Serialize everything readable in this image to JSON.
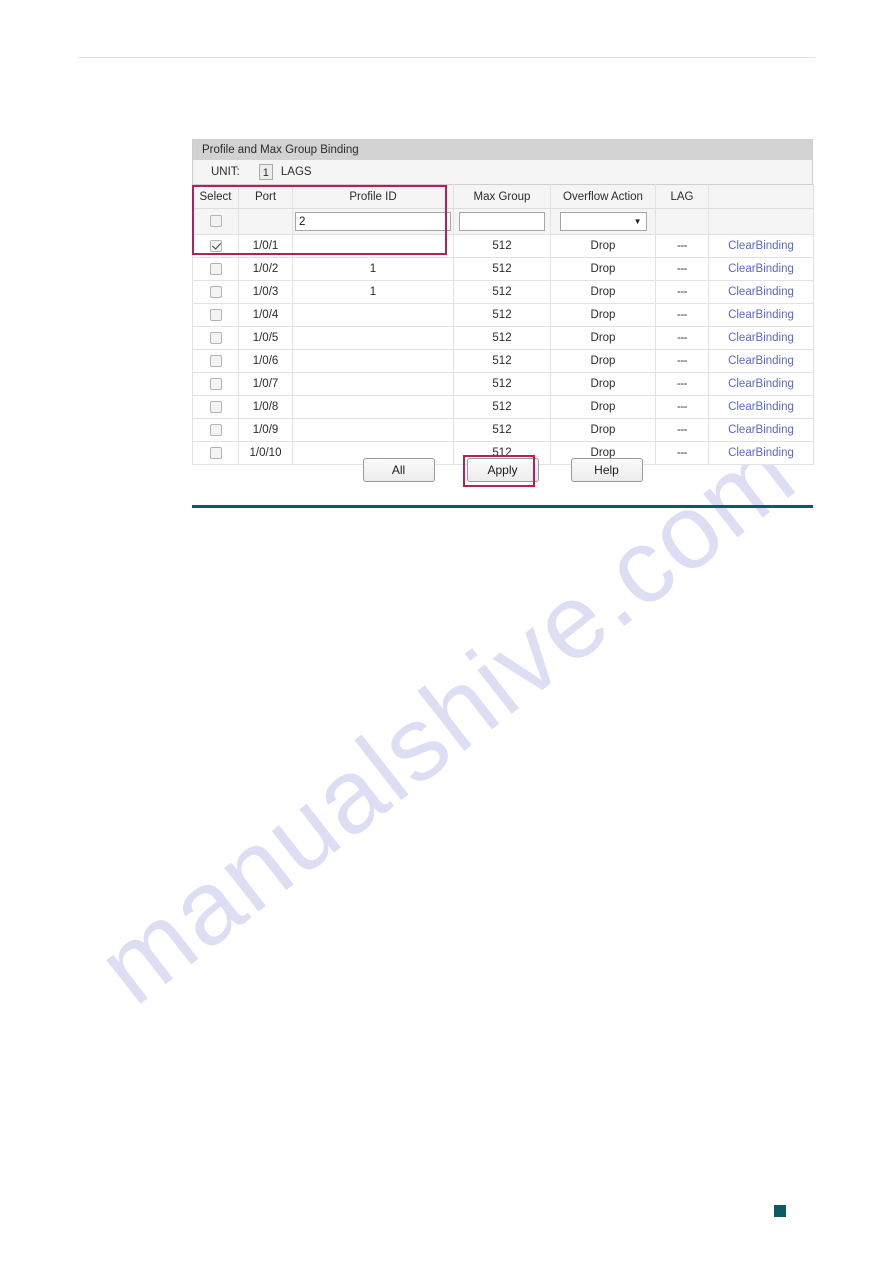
{
  "watermark": {
    "text": "manualshive.com"
  },
  "panel": {
    "title": "Profile and Max Group Binding",
    "unit": {
      "label": "UNIT:",
      "value": "1",
      "lags_label": "LAGS"
    },
    "columns": [
      "Select",
      "Port",
      "Profile ID",
      "Max Group",
      "Overflow Action",
      "LAG",
      ""
    ],
    "filter_row": {
      "select_checked": false,
      "port": "",
      "profile_id_value": "2",
      "profile_id_placeholder": "",
      "max_group_value": "",
      "max_group_placeholder": "",
      "overflow_action_value": "",
      "overflow_action_arrow": "▼",
      "lag": "",
      "action": ""
    },
    "rows": [
      {
        "selected": true,
        "port": "1/0/1",
        "profile_id": "",
        "max_group": "512",
        "overflow_action": "Drop",
        "lag": "---",
        "action": "ClearBinding"
      },
      {
        "selected": false,
        "port": "1/0/2",
        "profile_id": "1",
        "max_group": "512",
        "overflow_action": "Drop",
        "lag": "---",
        "action": "ClearBinding"
      },
      {
        "selected": false,
        "port": "1/0/3",
        "profile_id": "1",
        "max_group": "512",
        "overflow_action": "Drop",
        "lag": "---",
        "action": "ClearBinding"
      },
      {
        "selected": false,
        "port": "1/0/4",
        "profile_id": "",
        "max_group": "512",
        "overflow_action": "Drop",
        "lag": "---",
        "action": "ClearBinding"
      },
      {
        "selected": false,
        "port": "1/0/5",
        "profile_id": "",
        "max_group": "512",
        "overflow_action": "Drop",
        "lag": "---",
        "action": "ClearBinding"
      },
      {
        "selected": false,
        "port": "1/0/6",
        "profile_id": "",
        "max_group": "512",
        "overflow_action": "Drop",
        "lag": "---",
        "action": "ClearBinding"
      },
      {
        "selected": false,
        "port": "1/0/7",
        "profile_id": "",
        "max_group": "512",
        "overflow_action": "Drop",
        "lag": "---",
        "action": "ClearBinding"
      },
      {
        "selected": false,
        "port": "1/0/8",
        "profile_id": "",
        "max_group": "512",
        "overflow_action": "Drop",
        "lag": "---",
        "action": "ClearBinding"
      },
      {
        "selected": false,
        "port": "1/0/9",
        "profile_id": "",
        "max_group": "512",
        "overflow_action": "Drop",
        "lag": "---",
        "action": "ClearBinding"
      },
      {
        "selected": false,
        "port": "1/0/10",
        "profile_id": "",
        "max_group": "512",
        "overflow_action": "Drop",
        "lag": "---",
        "action": "ClearBinding"
      }
    ],
    "buttons": [
      {
        "label": "All",
        "highlighted": false
      },
      {
        "label": "Apply",
        "highlighted": true
      },
      {
        "label": "Help",
        "highlighted": false
      }
    ]
  },
  "colors": {
    "highlight_box": "#b81e5a",
    "link": "#5c68c6",
    "rule_teal": "#0d5b62",
    "title_bar": "#d2d2d2",
    "header_bg": "#f5f5f5"
  }
}
